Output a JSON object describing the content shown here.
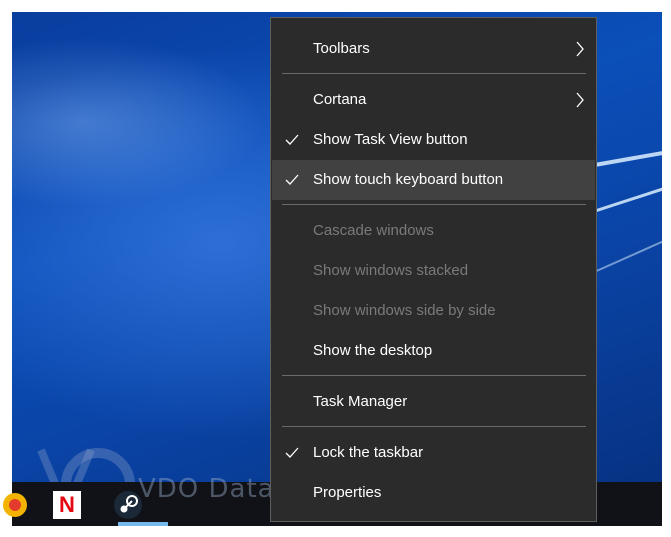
{
  "menu": {
    "items": [
      {
        "label": "Toolbars"
      },
      {
        "label": "Cortana"
      },
      {
        "label": "Show Task View button"
      },
      {
        "label": "Show touch keyboard button"
      },
      {
        "label": "Cascade windows"
      },
      {
        "label": "Show windows stacked"
      },
      {
        "label": "Show windows side by side"
      },
      {
        "label": "Show the desktop"
      },
      {
        "label": "Task Manager"
      },
      {
        "label": "Lock the taskbar"
      },
      {
        "label": "Properties"
      }
    ]
  },
  "taskbar": {
    "icons": [
      "chrome-icon",
      "netflix-icon",
      "steam-icon"
    ],
    "netflix_letter": "N"
  },
  "watermark": {
    "text": "VDO Data"
  },
  "colors": {
    "menu_bg": "#2b2b2b",
    "menu_hover": "#414141",
    "disabled_text": "#7a7a7a",
    "taskbar_bg": "#101217",
    "accent": "#76b9ed"
  }
}
